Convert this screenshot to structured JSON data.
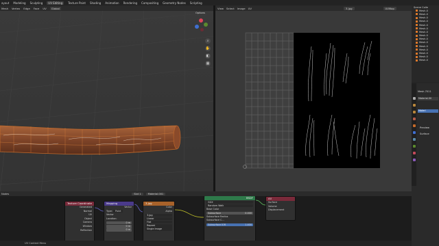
{
  "topbar": {
    "tabs": [
      "ayout",
      "Modeling",
      "Sculpting",
      "UV Editing",
      "Texture Paint",
      "Shading",
      "Animation",
      "Rendering",
      "Compositing",
      "Geometry Nodes",
      "Scripting"
    ],
    "active_tab": "UV Editing"
  },
  "viewport": {
    "menus": [
      "Mesh",
      "Vertex",
      "Edge",
      "Face",
      "UV"
    ],
    "transform": "Global",
    "options_label": "Options",
    "accent": "#c46a2a"
  },
  "uv_editor": {
    "menus": [
      "View",
      "Select",
      "Image",
      "UV"
    ],
    "image_name": "3.jpg",
    "view_mode": "UVMap"
  },
  "outliner": {
    "title": "Scene Colle",
    "items": [
      "Mesh.0",
      "Mesh.0",
      "Mesh.0",
      "Mesh.0",
      "Mesh.0",
      "Mesh.0",
      "Mesh.0",
      "Mesh.0",
      "Mesh.0",
      "Mesh.0",
      "Mesh.0",
      "Mesh.0",
      "Mesh.0",
      "Mesh.0",
      "Mesh.0"
    ]
  },
  "properties": {
    "object_name": "Mesh.7011",
    "material_field": "Material.00",
    "slot_label": "Materi",
    "preview_label": "Preview",
    "surface_label": "Surface"
  },
  "node_editor": {
    "label": "Nodes",
    "slot": "Slot 1",
    "material": "Material.001",
    "nodes": {
      "texcoord": {
        "title": "Texture Coordinate",
        "outputs": [
          "Generated",
          "Normal",
          "UV",
          "Object",
          "Camera",
          "Window",
          "Reflection"
        ]
      },
      "mapping": {
        "title": "Mapping",
        "out": "Vector",
        "type_label": "Type:",
        "type_value": "Point",
        "inputs": [
          "Vector",
          "Location:"
        ],
        "loc_values": [
          "0 m",
          "0 m",
          "0 m"
        ]
      },
      "image": {
        "title": "3.jpg",
        "outputs": [
          "Color",
          "Alpha"
        ],
        "image_field": "3.jpg",
        "options": [
          "Linear",
          "Flat",
          "Repeat",
          "Single Image"
        ]
      },
      "bsdf": {
        "title": "BSDF",
        "distribution": "GGX",
        "subsurface_method": "Random Walk",
        "rows": [
          "Base Color",
          "Subsurface",
          "Subsurface Radius",
          "Subsurface C...",
          "Subsurface IOR"
        ],
        "values": {
          "subsurface": "0.000",
          "ior": "1.400"
        }
      },
      "output": {
        "title": "All",
        "inputs": [
          "Surface",
          "Volume",
          "Displacement"
        ]
      }
    }
  },
  "statusbar": {
    "items": [
      "UV Context Menu"
    ]
  }
}
